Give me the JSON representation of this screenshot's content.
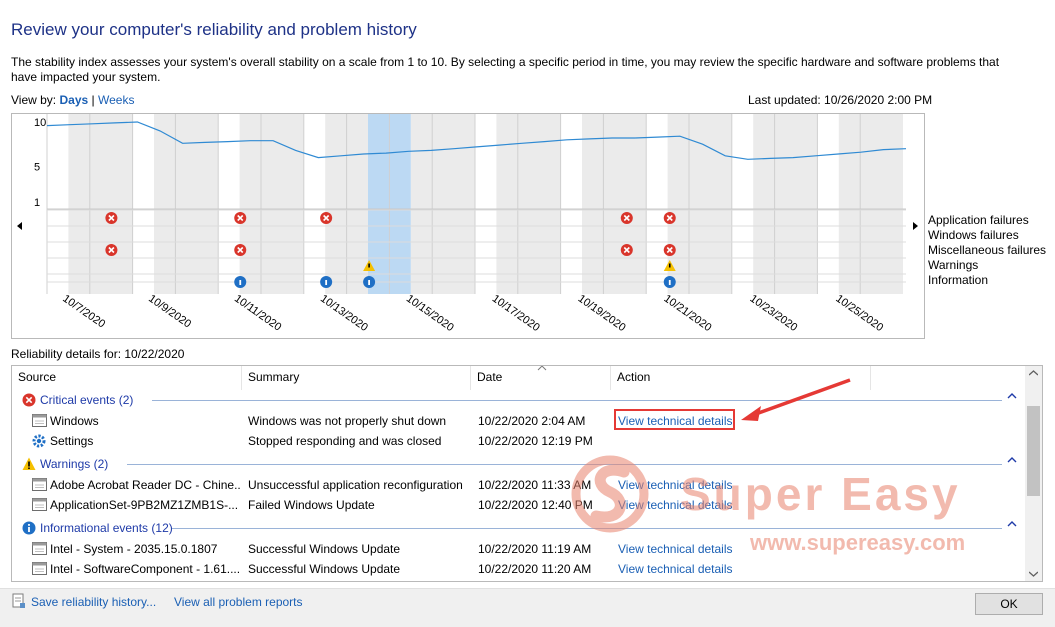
{
  "page_title": "Review your computer's reliability and problem history",
  "intro_text": "The stability index assesses your system's overall stability on a scale from 1 to 10. By selecting a specific period in time, you may review the specific hardware and software problems that have impacted your system.",
  "view_by": {
    "label": "View by:",
    "days": "Days",
    "separator": "|",
    "weeks": "Weeks",
    "selected": "Days"
  },
  "last_updated": "Last updated: 10/26/2020 2:00 PM",
  "chart_data": {
    "type": "line",
    "yticks": [
      "10",
      "5",
      "1"
    ],
    "ylim": [
      1,
      10
    ],
    "date_labels": [
      "10/7/2020",
      "10/9/2020",
      "10/11/2020",
      "10/13/2020",
      "10/15/2020",
      "10/17/2020",
      "10/19/2020",
      "10/21/2020",
      "10/23/2020",
      "10/25/2020"
    ],
    "selected_date": "10/22/2020",
    "legend": [
      "Application failures",
      "Windows failures",
      "Miscellaneous failures",
      "Warnings",
      "Information"
    ],
    "stability_index": [
      9.6,
      9.7,
      9.8,
      9.9,
      10.0,
      9.0,
      7.6,
      7.7,
      7.8,
      7.9,
      7.9,
      6.8,
      6.0,
      6.2,
      6.4,
      6.5,
      6.7,
      6.8,
      7.0,
      7.2,
      7.4,
      7.6,
      7.8,
      8.0,
      8.1,
      8.2,
      8.2,
      8.3,
      8.4,
      7.5,
      6.2,
      5.8,
      5.9,
      6.0,
      6.2,
      6.4,
      6.6,
      6.9,
      7.0
    ],
    "events": [
      {
        "day": 2,
        "row": "Application failures",
        "kind": "error"
      },
      {
        "day": 2,
        "row": "Miscellaneous failures",
        "kind": "error"
      },
      {
        "day": 5,
        "row": "Application failures",
        "kind": "error"
      },
      {
        "day": 5,
        "row": "Miscellaneous failures",
        "kind": "error"
      },
      {
        "day": 5,
        "row": "Information",
        "kind": "info"
      },
      {
        "day": 7,
        "row": "Application failures",
        "kind": "error"
      },
      {
        "day": 7,
        "row": "Information",
        "kind": "info"
      },
      {
        "day": 8,
        "row": "Warnings",
        "kind": "warning"
      },
      {
        "day": 8,
        "row": "Information",
        "kind": "info"
      },
      {
        "day": 14,
        "row": "Application failures",
        "kind": "error"
      },
      {
        "day": 14,
        "row": "Miscellaneous failures",
        "kind": "error"
      },
      {
        "day": 15,
        "row": "Application failures",
        "kind": "error"
      },
      {
        "day": 15,
        "row": "Miscellaneous failures",
        "kind": "error"
      },
      {
        "day": 15,
        "row": "Warnings",
        "kind": "warning"
      },
      {
        "day": 15,
        "row": "Information",
        "kind": "info"
      }
    ]
  },
  "details_label": "Reliability details for: 10/22/2020",
  "columns": [
    "Source",
    "Summary",
    "Date",
    "Action"
  ],
  "groups": [
    {
      "title": "Critical events (2)",
      "icon": "error-icon",
      "rows": [
        {
          "icon": "window-icon",
          "source": "Windows",
          "summary": "Windows was not properly shut down",
          "date": "10/22/2020 2:04 AM",
          "action": "View technical details"
        },
        {
          "icon": "gear-icon",
          "source": "Settings",
          "summary": "Stopped responding and was closed",
          "date": "10/22/2020 12:19 PM",
          "action": ""
        }
      ]
    },
    {
      "title": "Warnings (2)",
      "icon": "warning-icon",
      "rows": [
        {
          "icon": "window-icon",
          "source": "Adobe Acrobat Reader DC - Chine...",
          "summary": "Unsuccessful application reconfiguration",
          "date": "10/22/2020 11:33 AM",
          "action": "View technical details"
        },
        {
          "icon": "window-icon",
          "source": "ApplicationSet-9PB2MZ1ZMB1S-...",
          "summary": "Failed Windows Update",
          "date": "10/22/2020 12:40 PM",
          "action": "View technical details"
        }
      ]
    },
    {
      "title": "Informational events (12)",
      "icon": "info-icon",
      "rows": [
        {
          "icon": "window-icon",
          "source": "Intel - System - 2035.15.0.1807",
          "summary": "Successful Windows Update",
          "date": "10/22/2020 11:19 AM",
          "action": "View technical details"
        },
        {
          "icon": "window-icon",
          "source": "Intel - SoftwareComponent - 1.61....",
          "summary": "Successful Windows Update",
          "date": "10/22/2020 11:20 AM",
          "action": "View technical details"
        }
      ]
    }
  ],
  "footer": {
    "save_link": "Save reliability history...",
    "view_all_link": "View all problem reports",
    "ok_label": "OK"
  },
  "watermark": {
    "brand": "Super Easy",
    "url": "www.supereasy.com"
  },
  "colors": {
    "title": "#1e3287",
    "link": "#1a5fb4",
    "error": "#d9352b",
    "warning": "#f5c000",
    "info": "#1f6fc5",
    "line": "#2f8ad3",
    "selected": "#bcd9f3",
    "callout": "#e53935"
  }
}
